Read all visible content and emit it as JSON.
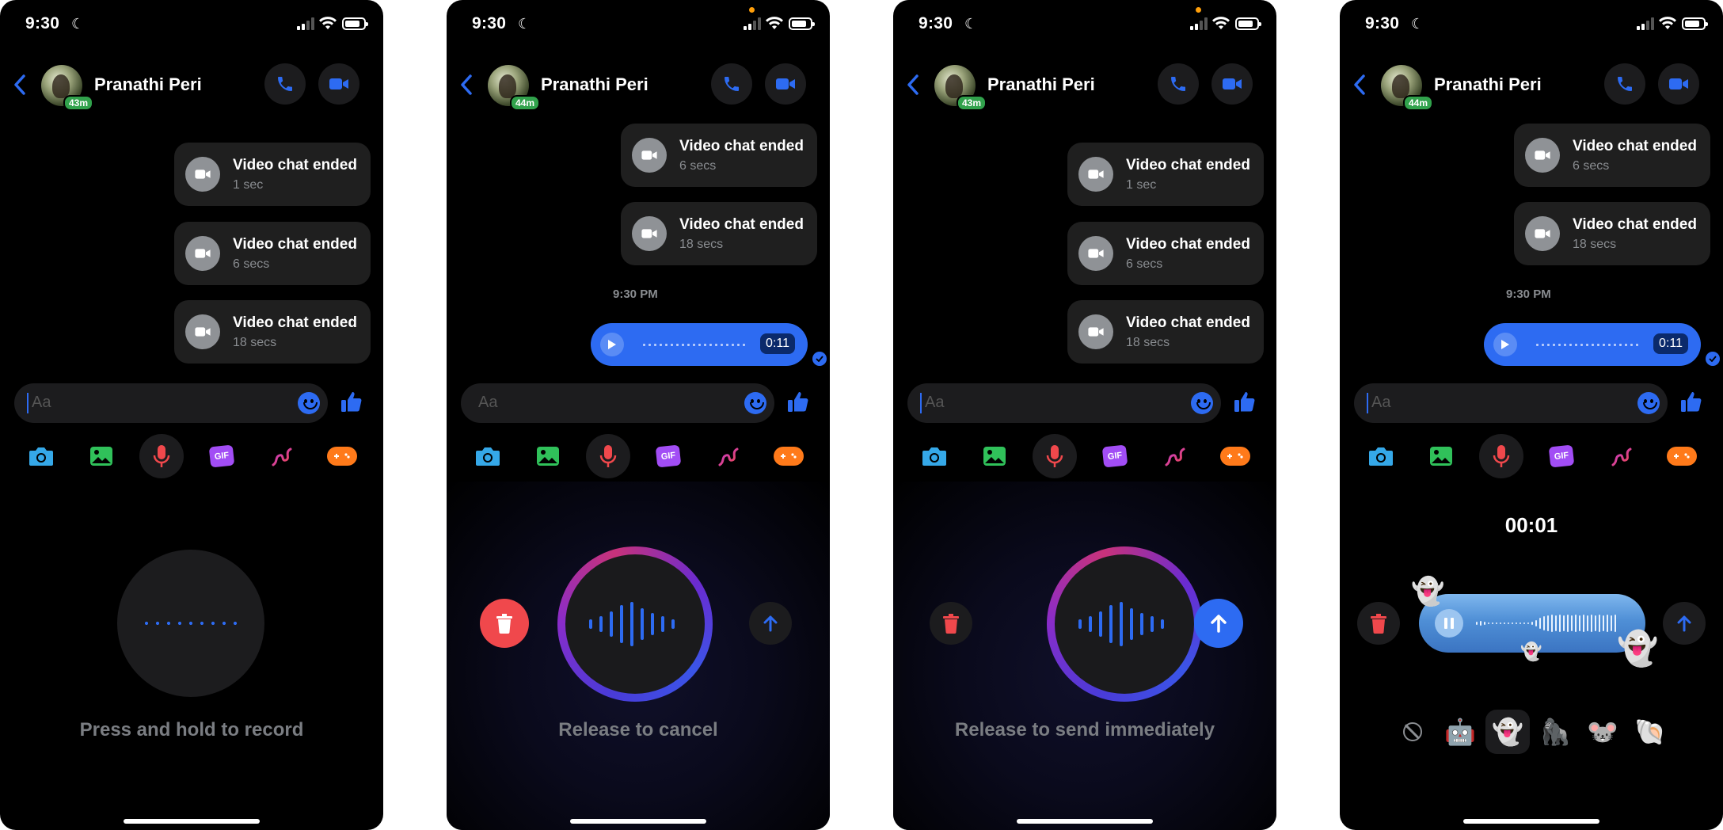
{
  "status": {
    "time": "9:30"
  },
  "header": {
    "name": "Pranathi Peri",
    "active_s1": "43m",
    "active_s2": "44m",
    "active_s3": "43m",
    "active_s4": "44m"
  },
  "messages_a": [
    {
      "title": "Video chat ended",
      "sub": "1 sec"
    },
    {
      "title": "Video chat ended",
      "sub": "6 secs"
    },
    {
      "title": "Video chat ended",
      "sub": "18 secs"
    }
  ],
  "messages_b": [
    {
      "title": "Video chat ended",
      "sub": "6 secs"
    },
    {
      "title": "Video chat ended",
      "sub": "18 secs"
    }
  ],
  "voice_message": {
    "timestamp": "9:30 PM",
    "duration": "0:11"
  },
  "composer": {
    "placeholder": "Aa"
  },
  "toolbar": {
    "gif_label": "GIF"
  },
  "screens": {
    "s1_caption": "Press and hold to record",
    "s2_caption": "Release to cancel",
    "s3_caption": "Release to send immediately",
    "s4_timer": "00:01"
  },
  "effects": [
    "none",
    "robot",
    "ghost",
    "gorilla",
    "mouse",
    "shell"
  ],
  "colors": {
    "accent": "#2d6bf2",
    "danger": "#f0484c",
    "background": "#000000",
    "bubble": "#1f1f1f"
  }
}
